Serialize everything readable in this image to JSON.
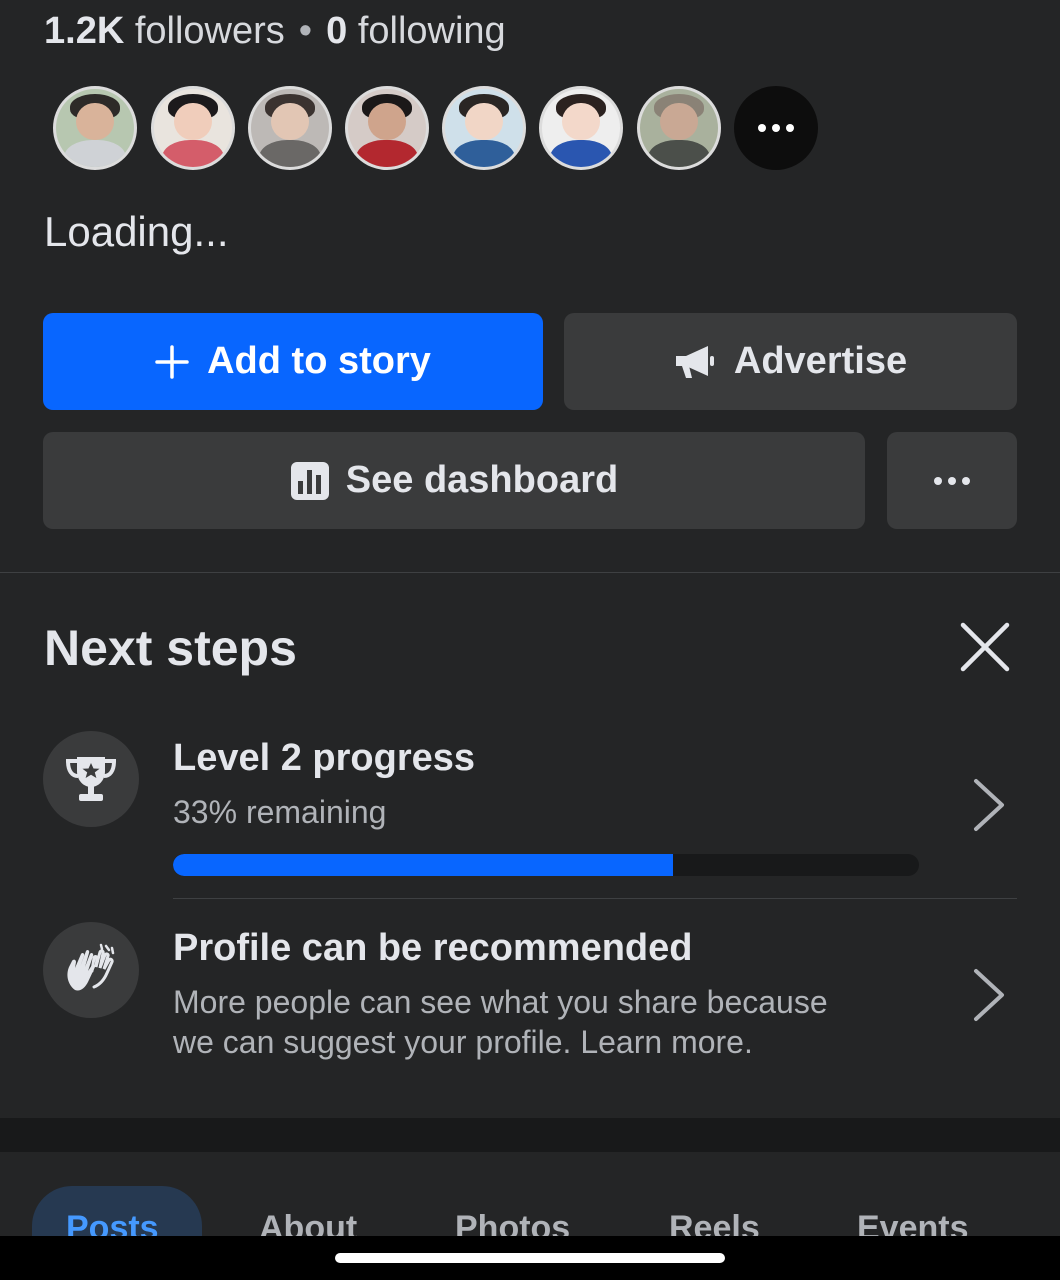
{
  "stats": {
    "followers_count": "1.2K",
    "followers_label": "followers",
    "separator": "•",
    "following_count": "0",
    "following_label": "following"
  },
  "loading_text": "Loading...",
  "actions": {
    "add_story_label": "Add to story",
    "advertise_label": "Advertise",
    "dashboard_label": "See dashboard"
  },
  "next_steps": {
    "title": "Next steps",
    "items": [
      {
        "title": "Level 2 progress",
        "subtitle": "33% remaining",
        "progress_fraction": 0.67
      },
      {
        "title": "Profile can be recommended",
        "description_line1": "More people can see what you share because",
        "description_line2": "we can suggest your profile. Learn more."
      }
    ]
  },
  "tabs": [
    "Posts",
    "About",
    "Photos",
    "Reels",
    "Events"
  ],
  "active_tab": "Posts",
  "colors": {
    "background": "#242526",
    "accent_blue": "#0866ff",
    "secondary_button": "#3a3b3c",
    "text_primary": "#e4e6eb",
    "text_secondary": "#b0b3b8"
  }
}
